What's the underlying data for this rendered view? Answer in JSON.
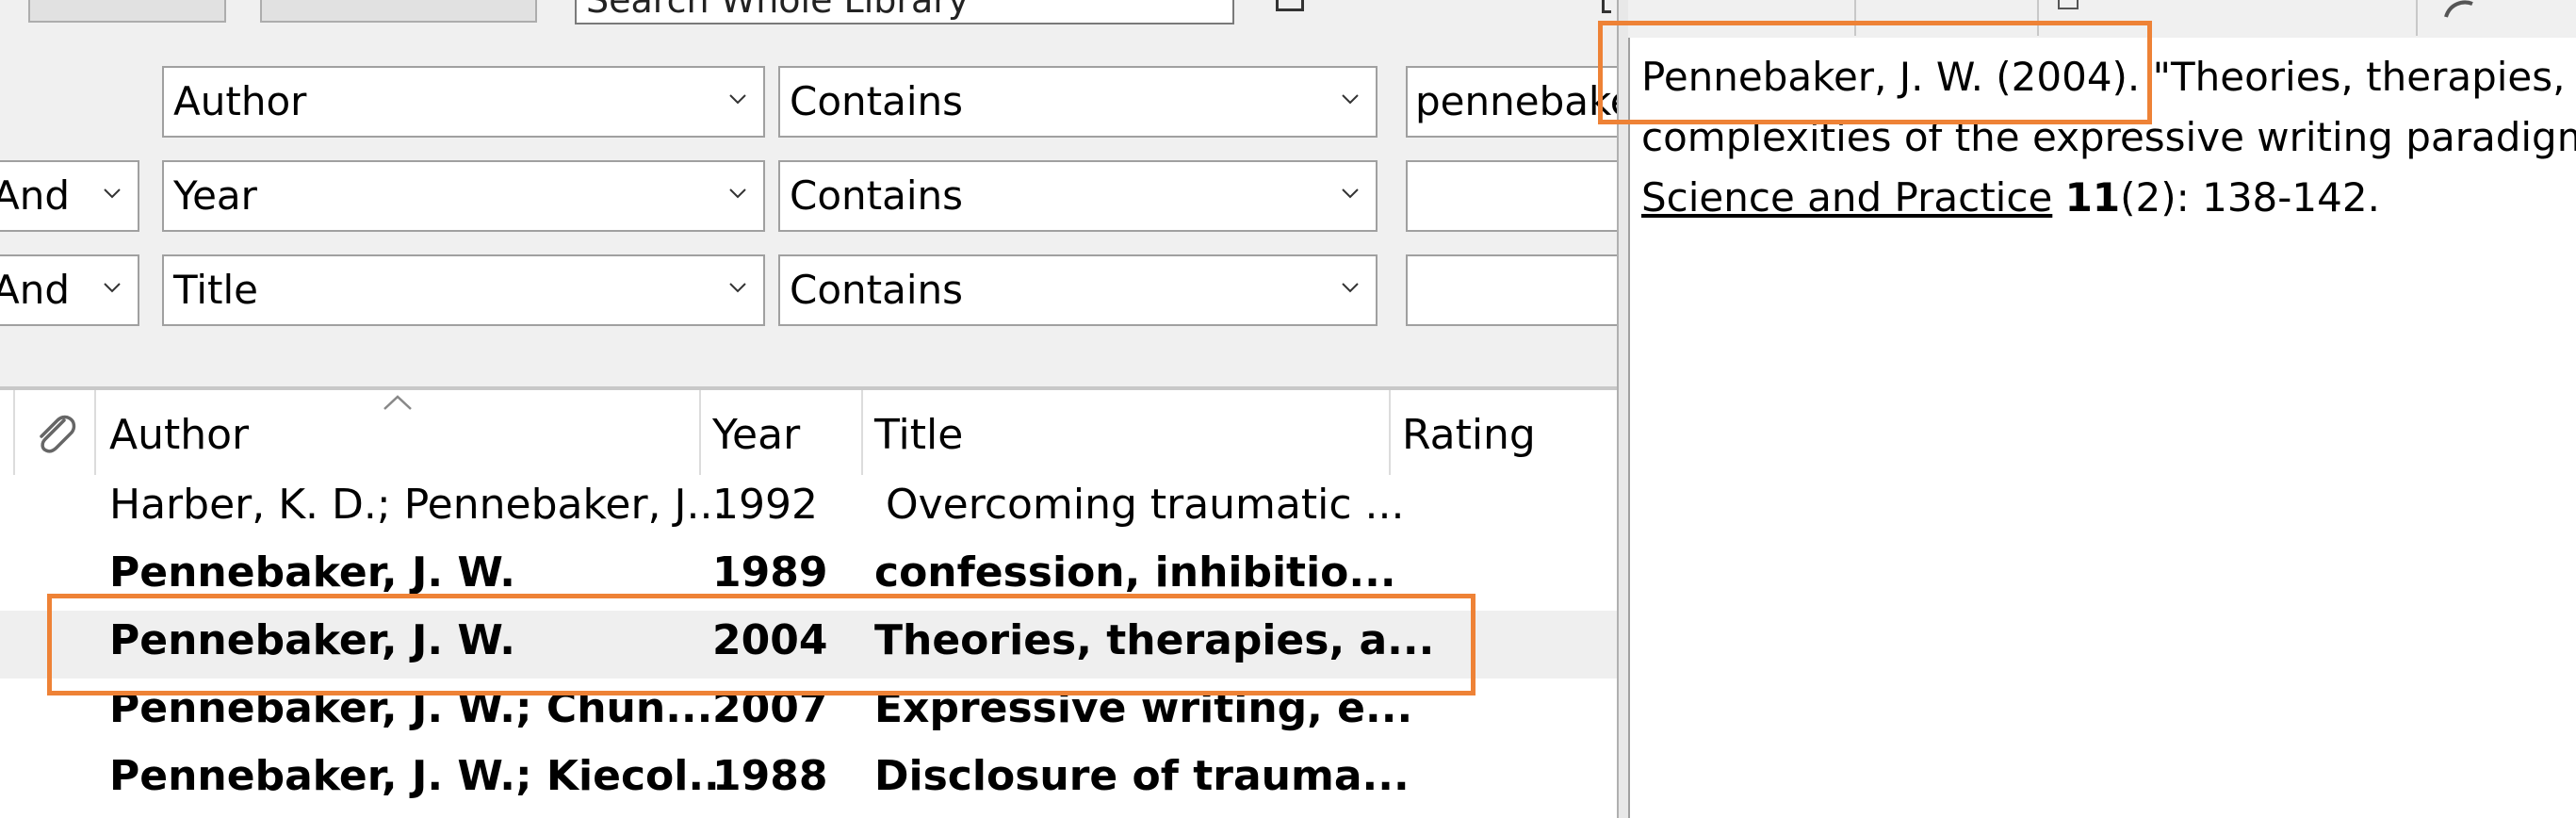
{
  "toolbar": {
    "search_placeholder": "Search Whole Library"
  },
  "search": {
    "rows": [
      {
        "connector": "",
        "field": "Author",
        "operator": "Contains",
        "value": "pennebaker"
      },
      {
        "connector": "And",
        "field": "Year",
        "operator": "Contains",
        "value": ""
      },
      {
        "connector": "And",
        "field": "Title",
        "operator": "Contains",
        "value": ""
      }
    ]
  },
  "list": {
    "columns": {
      "author": "Author",
      "year": "Year",
      "title": "Title",
      "rating": "Rating"
    },
    "rows": [
      {
        "author": "Harber, K. D.; Pennebaker, J...",
        "year": "1992",
        "title": "Overcoming traumatic ...",
        "bold": false
      },
      {
        "author": "Pennebaker, J. W.",
        "year": "1989",
        "title": "confession, inhibitio...",
        "bold": true
      },
      {
        "author": "Pennebaker, J. W.",
        "year": "2004",
        "title": "Theories, therapies, a...",
        "bold": true,
        "selected": true
      },
      {
        "author": "Pennebaker, J. W.; Chun...",
        "year": "2007",
        "title": "Expressive writing, e...",
        "bold": true
      },
      {
        "author": "Pennebaker, J. W.; Kiecol...",
        "year": "1988",
        "title": "Disclosure of trauma...",
        "bold": true
      }
    ]
  },
  "preview": {
    "line1_lead": "Pennebaker, J. W. (2004).",
    "line1_rest": " \"Theories, therapies, and taxonomies:",
    "line2": "complexities of the expressive writing paradigm.\" Clinical Psychology:",
    "line3_journal": "Science and Practice",
    "line3_volume": "11",
    "line3_rest": "(2): 138-142."
  },
  "colors": {
    "highlight": "#ee8236",
    "selected_row": "#efefef"
  }
}
